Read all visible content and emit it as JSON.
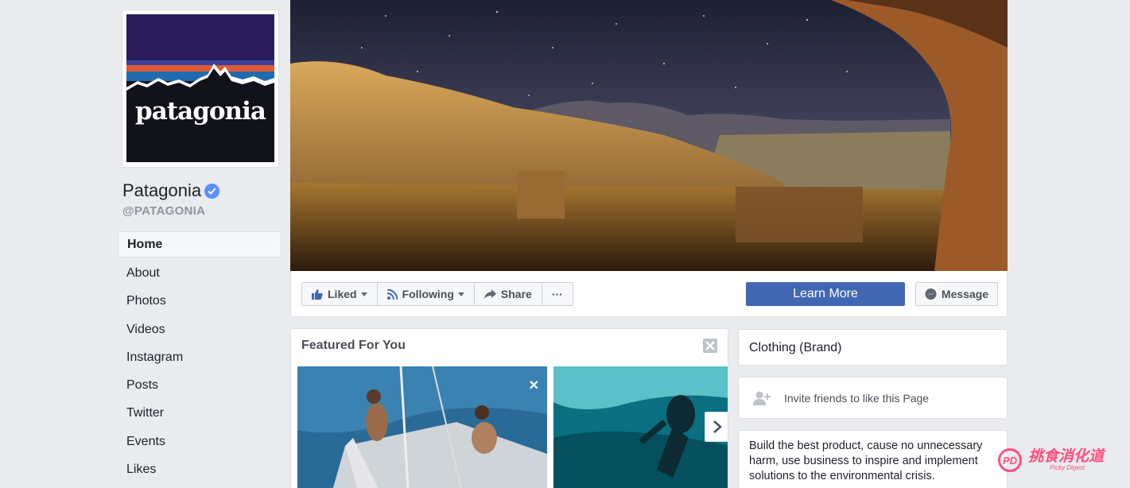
{
  "profile": {
    "logo_text": "patagonia",
    "name": "Patagonia",
    "handle": "@PATAGONIA"
  },
  "nav": {
    "items": [
      "Home",
      "About",
      "Photos",
      "Videos",
      "Instagram",
      "Posts",
      "Twitter",
      "Events",
      "Likes"
    ],
    "active": "Home"
  },
  "actions": {
    "liked": "Liked",
    "following": "Following",
    "share": "Share",
    "more": "···",
    "learn_more": "Learn More",
    "message": "Message"
  },
  "featured": {
    "title": "Featured For You",
    "thumb_close": "✕"
  },
  "sidebar": {
    "category": "Clothing (Brand)",
    "invite": "Invite friends to like this Page",
    "about": "Build the best product, cause no unnecessary harm, use business to inspire and implement solutions to the environmental crisis."
  },
  "watermark": {
    "logo": "PD",
    "text": "挑食消化道",
    "sub": "Picky Digest"
  },
  "colors": {
    "primary": "#4267b2",
    "verified": "#5890ff",
    "background": "#e9ebee"
  }
}
